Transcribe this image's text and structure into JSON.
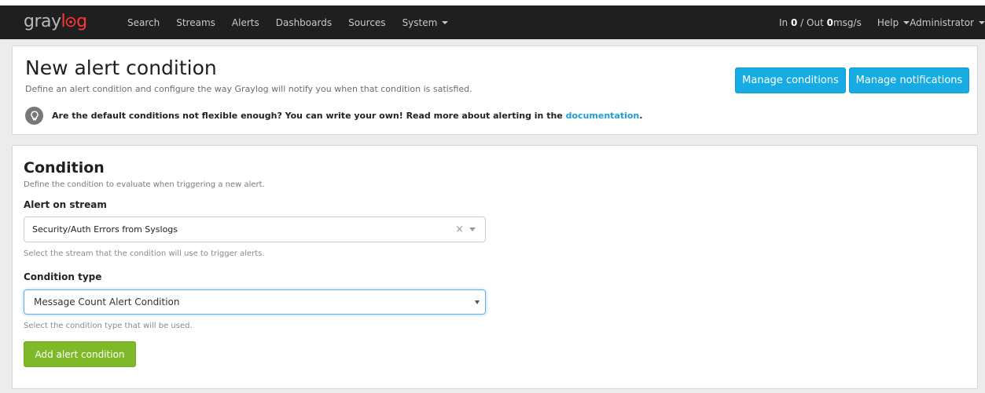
{
  "brand": {
    "part1": "gray",
    "part2": "l",
    "part3": "g"
  },
  "navbar": {
    "items": [
      "Search",
      "Streams",
      "Alerts",
      "Dashboards",
      "Sources",
      "System"
    ],
    "throughput": {
      "in_label": "In",
      "in_value": "0",
      "sep": "/ Out",
      "out_value": "0",
      "unit": "msg/s"
    },
    "help": "Help",
    "user": "Administrator"
  },
  "header": {
    "title": "New alert condition",
    "description": "Define an alert condition and configure the way Graylog will notify you when that condition is satisfied.",
    "hint": "Are the default conditions not flexible enough? You can write your own! Read more about alerting in the",
    "hint_link": "documentation",
    "hint_end": ".",
    "manage_conditions": "Manage conditions",
    "manage_notifications": "Manage notifications"
  },
  "condition": {
    "title": "Condition",
    "description": "Define the condition to evaluate when triggering a new alert.",
    "stream_label": "Alert on stream",
    "stream_value": "Security/Auth Errors from Syslogs",
    "stream_clear": "×",
    "stream_help": "Select the stream that the condition will use to trigger alerts.",
    "type_label": "Condition type",
    "type_value": "Message Count Alert Condition",
    "type_help": "Select the condition type that will be used.",
    "add_button": "Add alert condition"
  },
  "colors": {
    "navbar_bg": "#1f1f1f",
    "brand_accent": "#ff3633",
    "primary_blue": "#16ace3",
    "success_green": "#7eb928",
    "link": "#1c9fd4"
  }
}
